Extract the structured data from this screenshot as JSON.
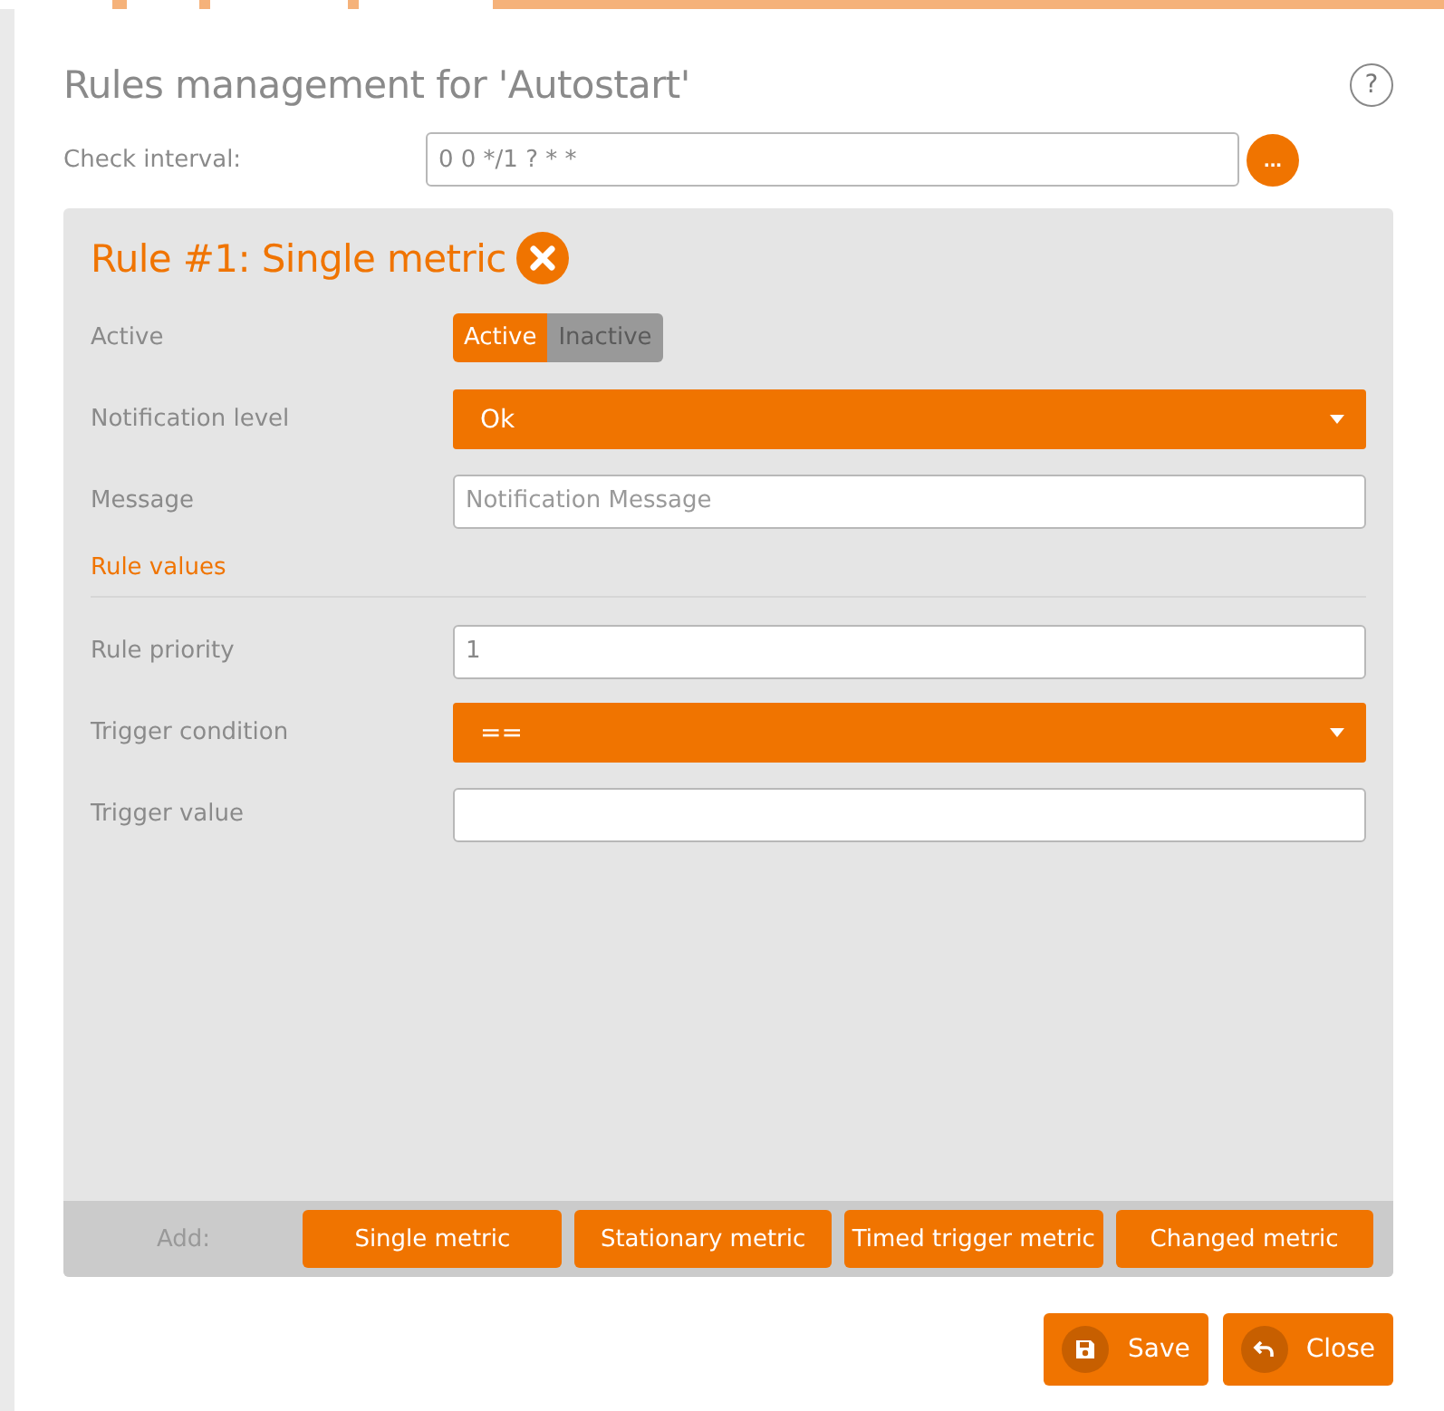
{
  "dialog": {
    "title": "Rules management for 'Autostart'",
    "help": "?"
  },
  "check_interval": {
    "label": "Check interval:",
    "value": "0 0 */1 ? * *",
    "button": "..."
  },
  "rule": {
    "title": "Rule #1: Single metric",
    "fields": [
      {
        "kind": "toggle",
        "label": "Active",
        "options": [
          {
            "label": "Active",
            "selected": true
          },
          {
            "label": "Inactive",
            "selected": false
          }
        ]
      },
      {
        "kind": "select",
        "label": "Notification level",
        "value": "Ok"
      },
      {
        "kind": "input",
        "label": "Message",
        "placeholder": "Notification Message"
      },
      {
        "kind": "section",
        "label": "Rule values"
      },
      {
        "kind": "input",
        "label": "Rule priority",
        "value": "1"
      },
      {
        "kind": "select",
        "label": "Trigger condition",
        "value": "=="
      },
      {
        "kind": "input",
        "label": "Trigger value"
      }
    ]
  },
  "add_bar": {
    "label": "Add:",
    "buttons": [
      "Single metric",
      "Stationary metric",
      "Timed trigger metric",
      "Changed metric"
    ]
  },
  "footer": [
    {
      "label": "Save",
      "kind": "save"
    },
    {
      "label": "Close",
      "kind": "close"
    }
  ]
}
